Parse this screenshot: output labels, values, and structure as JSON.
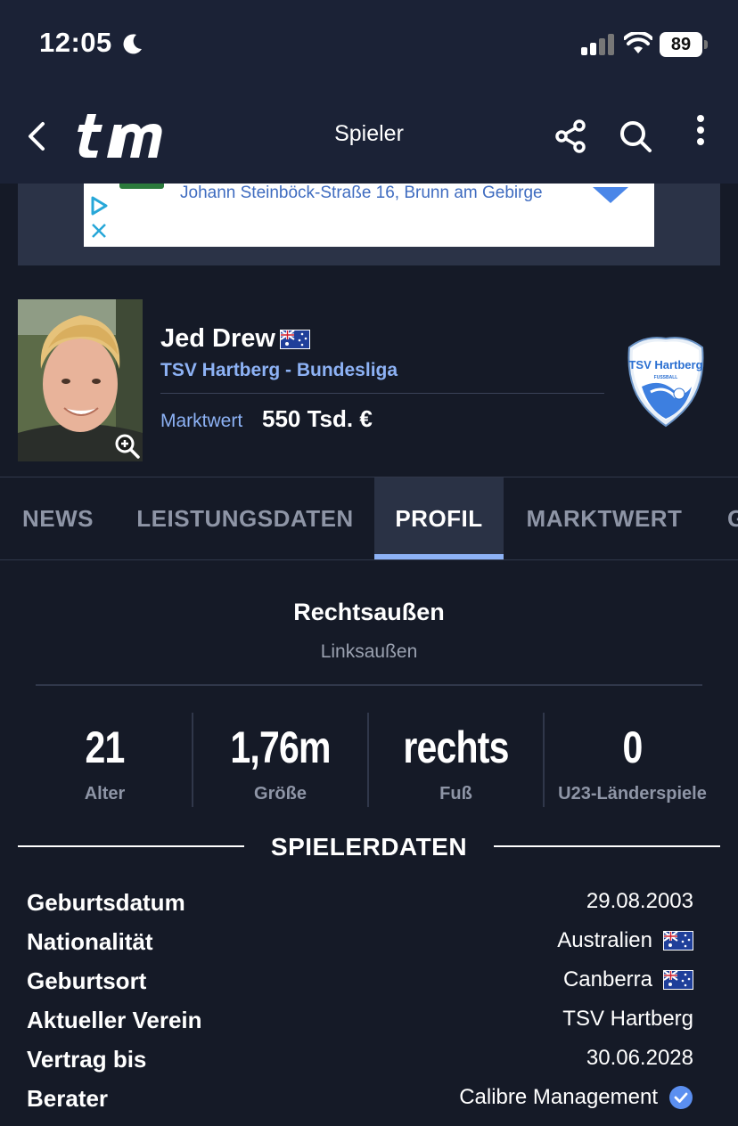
{
  "status_bar": {
    "time": "12:05",
    "battery": "89"
  },
  "header": {
    "title": "Spieler"
  },
  "ad": {
    "address": "Johann Steinböck-Straße 16, Brunn am Gebirge"
  },
  "player": {
    "name": "Jed Drew",
    "club_league": "TSV Hartberg - Bundesliga",
    "market_value_label": "Marktwert",
    "market_value": "550 Tsd. €",
    "club_crest_text": "TSV Hartberg",
    "club_crest_subtext": "FUSSBALL"
  },
  "tabs": [
    {
      "label": "NEWS",
      "active": false
    },
    {
      "label": "LEISTUNGSDATEN",
      "active": false
    },
    {
      "label": "PROFIL",
      "active": true
    },
    {
      "label": "MARKTWERT",
      "active": false
    },
    {
      "label": "G",
      "active": false
    }
  ],
  "positions": {
    "main": "Rechtsaußen",
    "secondary": "Linksaußen"
  },
  "stats": [
    {
      "value": "21",
      "label": "Alter"
    },
    {
      "value": "1,76m",
      "label": "Größe"
    },
    {
      "value": "rechts",
      "label": "Fuß"
    },
    {
      "value": "0",
      "label": "U23-Länderspiele"
    }
  ],
  "section": {
    "title": "SPIELERDATEN"
  },
  "player_data": [
    {
      "label": "Geburtsdatum",
      "value": "29.08.2003",
      "icon": ""
    },
    {
      "label": "Nationalität",
      "value": "Australien",
      "icon": "flag-au"
    },
    {
      "label": "Geburtsort",
      "value": "Canberra",
      "icon": "flag-au"
    },
    {
      "label": "Aktueller Verein",
      "value": "TSV Hartberg",
      "icon": ""
    },
    {
      "label": "Vertrag bis",
      "value": "30.06.2028",
      "icon": ""
    },
    {
      "label": "Berater",
      "value": "Calibre Management",
      "icon": "verified-icon"
    }
  ],
  "colors": {
    "background": "#151a27",
    "header": "#1b2236",
    "accent": "#8db2f5",
    "muted": "#8e95a6"
  }
}
